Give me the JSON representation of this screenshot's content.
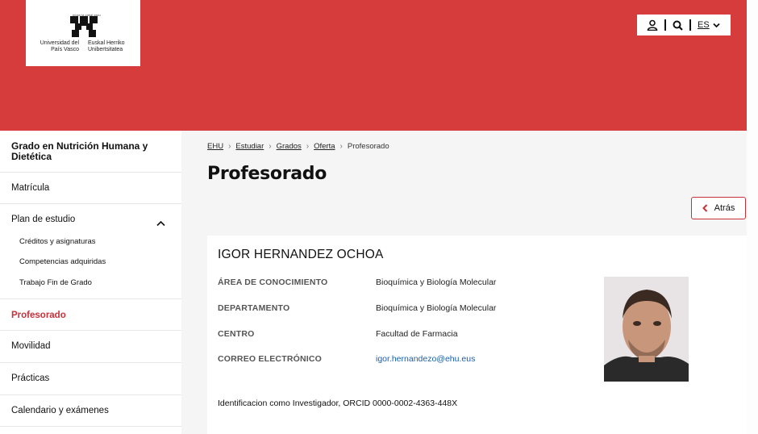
{
  "header": {
    "brand_color": "#d73c3d",
    "logo": {
      "line_small": "eman ta zabal zazu",
      "spanish_name": "Universidad del País Vasco",
      "basque_name": "Euskal Herriko Unibertsitatea"
    },
    "utility": {
      "user_icon": "user-icon",
      "search_icon": "search-icon",
      "language": "ES"
    }
  },
  "sidebar": {
    "title": "Grado en Nutrición Humana y Dietética",
    "items": [
      {
        "label": "Matrícula"
      },
      {
        "label": "Plan de estudio",
        "expanded": true,
        "children": [
          {
            "label": "Créditos y asignaturas"
          },
          {
            "label": "Competencias adquiridas"
          },
          {
            "label": "Trabajo Fin de Grado"
          }
        ]
      },
      {
        "label": "Profesorado",
        "active": true
      },
      {
        "label": "Movilidad"
      },
      {
        "label": "Prácticas"
      },
      {
        "label": "Calendario y exámenes"
      }
    ]
  },
  "breadcrumb": [
    "EHU",
    "Estudiar",
    "Grados",
    "Oferta",
    "Profesorado"
  ],
  "page_title": "Profesorado",
  "back_label": "Atrás",
  "professor": {
    "name": "IGOR HERNANDEZ OCHOA",
    "fields": [
      {
        "label": "ÁREA DE CONOCIMIENTO",
        "value": "Bioquímica y Biología Molecular"
      },
      {
        "label": "DEPARTAMENTO",
        "value": "Bioquímica y Biología Molecular"
      },
      {
        "label": "CENTRO",
        "value": "Facultad de Farmacia"
      },
      {
        "label": "CORREO ELECTRÓNICO",
        "value": "igor.hernandezo@ehu.eus"
      }
    ],
    "orcid_text": "Identificacion como Investigador, ORCID 0000-0002-4363-448X"
  }
}
